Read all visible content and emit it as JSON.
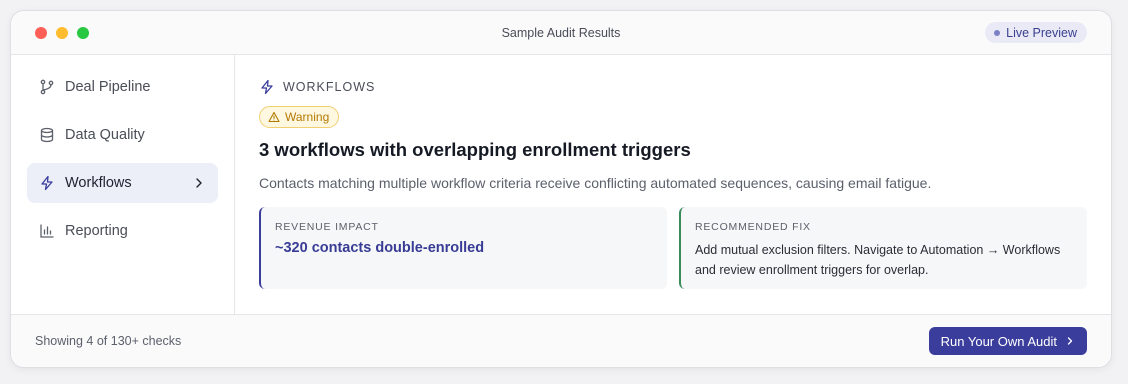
{
  "window": {
    "title": "Sample Audit Results",
    "live_badge": "Live Preview"
  },
  "sidebar": {
    "items": [
      {
        "label": "Deal Pipeline",
        "icon": "git-branch-icon",
        "active": false
      },
      {
        "label": "Data Quality",
        "icon": "database-icon",
        "active": false
      },
      {
        "label": "Workflows",
        "icon": "lightning-icon",
        "active": true
      },
      {
        "label": "Reporting",
        "icon": "bar-chart-icon",
        "active": false
      }
    ]
  },
  "main": {
    "section_label": "WORKFLOWS",
    "badge": "Warning",
    "title": "3 workflows with overlapping enrollment triggers",
    "description": "Contacts matching multiple workflow criteria receive conflicting automated sequences, causing email fatigue.",
    "impact": {
      "label": "REVENUE IMPACT",
      "value": "~320 contacts double-enrolled"
    },
    "fix": {
      "label": "RECOMMENDED FIX",
      "line1": "Add mutual exclusion filters. Navigate to Automation → Workflows",
      "line2": "and review enrollment triggers for overlap."
    }
  },
  "footer": {
    "status": "Showing 4 of 130+ checks",
    "cta_label": "Run Your Own Audit"
  },
  "colors": {
    "accent": "#3a3d9c",
    "warning": "#b37800",
    "fix_border": "#3a8a5c"
  }
}
